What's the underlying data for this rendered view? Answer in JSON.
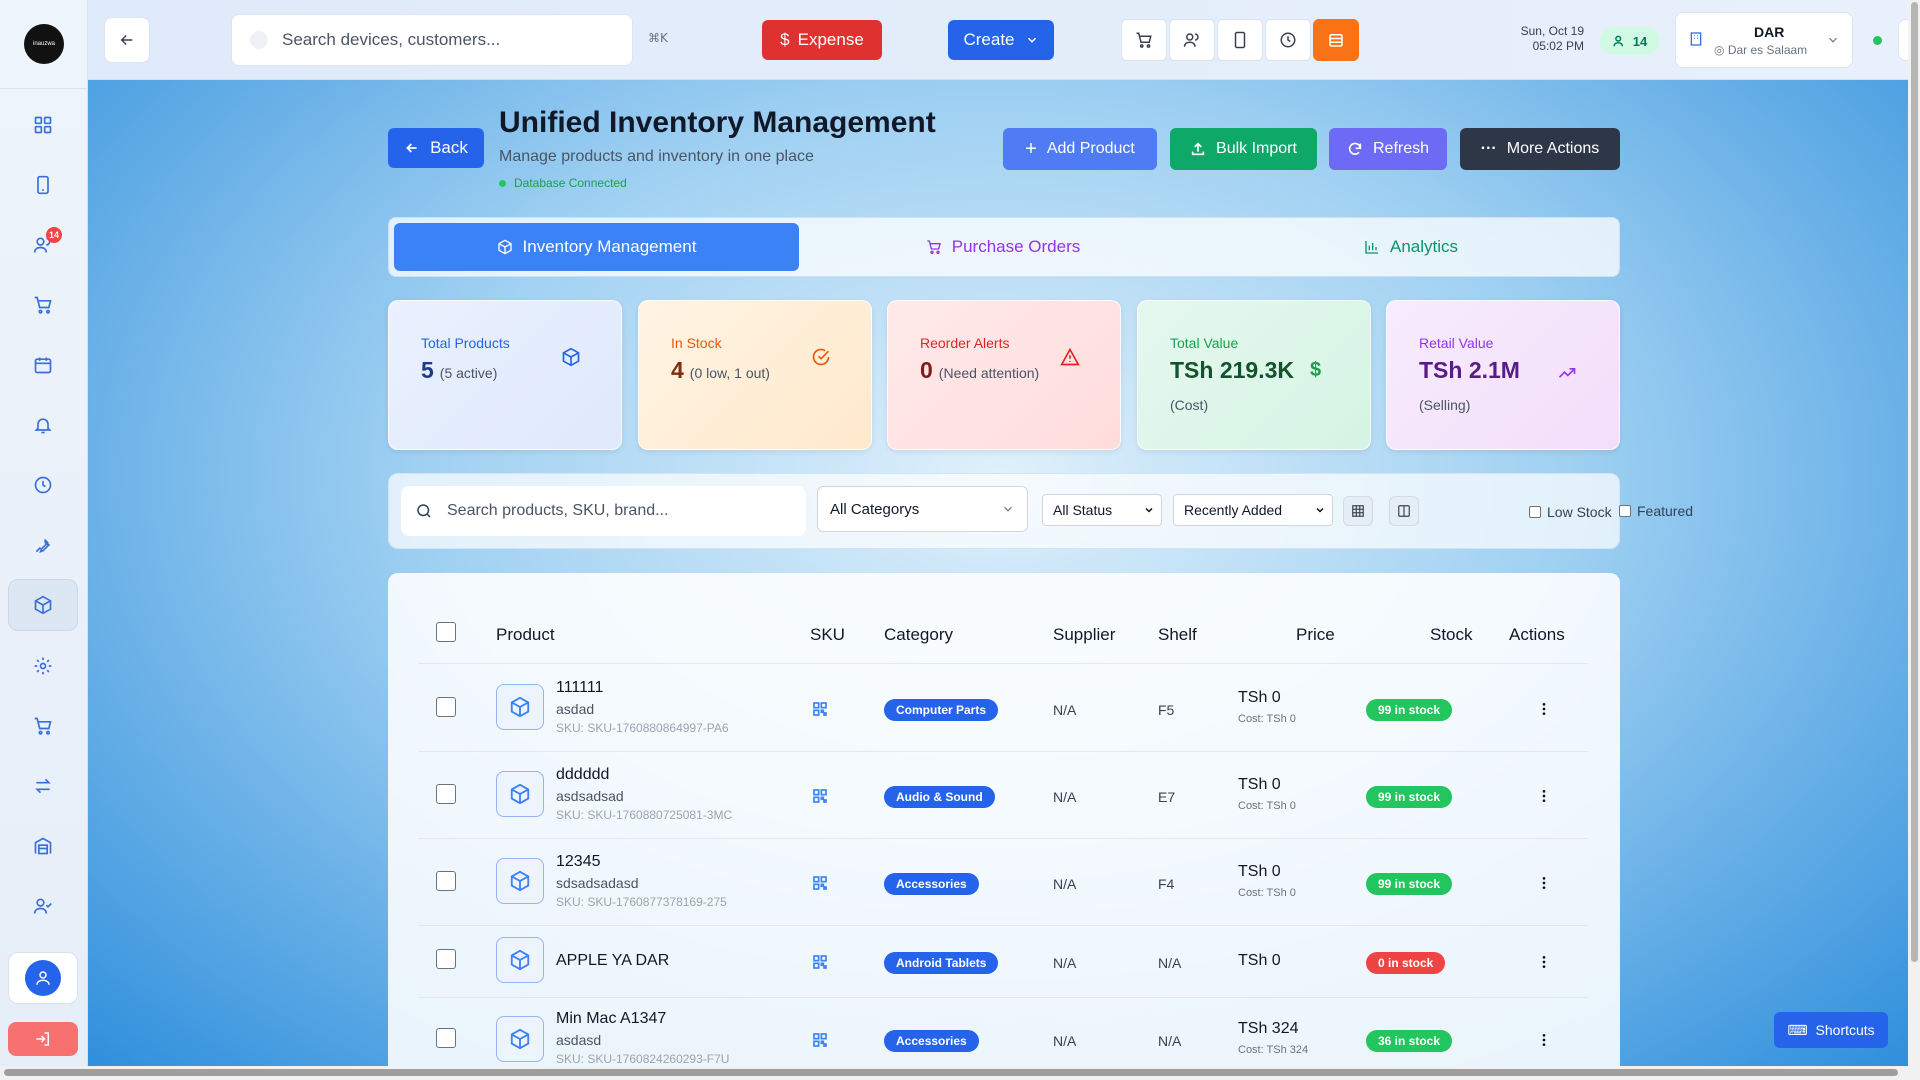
{
  "brand": {
    "logo_text": "inauzwa"
  },
  "sidebar": {
    "notification_badge": "14"
  },
  "topbar": {
    "search_placeholder": "Search devices, customers...",
    "shortcut_hint": "⌘K",
    "expense_label": "Expense",
    "create_label": "Create",
    "date": "Sun, Oct 19",
    "time": "05:02 PM",
    "online_users": "14",
    "branch_code": "DAR",
    "branch_location": "Dar es Salaam",
    "avatar_initial": "U"
  },
  "page": {
    "back_label": "Back",
    "title": "Unified Inventory Management",
    "subtitle": "Manage products and inventory in one place",
    "db_status": "Database Connected",
    "actions": {
      "add_product": "Add Product",
      "bulk_import": "Bulk Import",
      "refresh": "Refresh",
      "more": "More Actions"
    },
    "tabs": {
      "inventory": "Inventory Management",
      "purchase_orders": "Purchase Orders",
      "analytics": "Analytics"
    }
  },
  "stats": {
    "total_products": {
      "label": "Total Products",
      "value": "5",
      "note": "(5 active)"
    },
    "in_stock": {
      "label": "In Stock",
      "value": "4",
      "note": "(0 low, 1 out)"
    },
    "reorder": {
      "label": "Reorder Alerts",
      "value": "0",
      "note": "(Need attention)"
    },
    "total_value": {
      "label": "Total Value",
      "value": "TSh 219.3K",
      "note": "(Cost)"
    },
    "retail_value": {
      "label": "Retail Value",
      "value": "TSh 2.1M",
      "note": "(Selling)"
    }
  },
  "filters": {
    "search_placeholder": "Search products, SKU, brand...",
    "category": "All Categorys",
    "status": "All Status",
    "sort": "Recently Added",
    "low_stock": "Low Stock",
    "featured": "Featured"
  },
  "table": {
    "headers": {
      "product": "Product",
      "sku": "SKU",
      "category": "Category",
      "supplier": "Supplier",
      "shelf": "Shelf",
      "price": "Price",
      "stock": "Stock",
      "actions": "Actions"
    },
    "rows": [
      {
        "name": "111111",
        "desc": "asdad",
        "sku": "SKU: SKU-1760880864997-PA6",
        "category": "Computer Parts",
        "supplier": "N/A",
        "shelf": "F5",
        "price": "TSh 0",
        "cost": "Cost: TSh 0",
        "stock": "99 in stock"
      },
      {
        "name": "dddddd",
        "desc": "asdsadsad",
        "sku": "SKU: SKU-1760880725081-3MC",
        "category": "Audio & Sound",
        "supplier": "N/A",
        "shelf": "E7",
        "price": "TSh 0",
        "cost": "Cost: TSh 0",
        "stock": "99 in stock"
      },
      {
        "name": "12345",
        "desc": "sdsadsadasd",
        "sku": "SKU: SKU-1760877378169-275",
        "category": "Accessories",
        "supplier": "N/A",
        "shelf": "F4",
        "price": "TSh 0",
        "cost": "Cost: TSh 0",
        "stock": "99 in stock"
      },
      {
        "name": "APPLE YA DAR",
        "desc": "",
        "sku": "",
        "category": "Android Tablets",
        "supplier": "N/A",
        "shelf": "N/A",
        "price": "TSh 0",
        "cost": "",
        "stock": "0 in stock"
      },
      {
        "name": "Min Mac A1347",
        "desc": "asdasd",
        "sku": "SKU: SKU-1760824260293-F7U",
        "category": "Accessories",
        "supplier": "N/A",
        "shelf": "N/A",
        "price": "TSh 324",
        "cost": "Cost: TSh 324",
        "stock": "36 in stock"
      }
    ]
  },
  "shortcuts_label": "Shortcuts"
}
